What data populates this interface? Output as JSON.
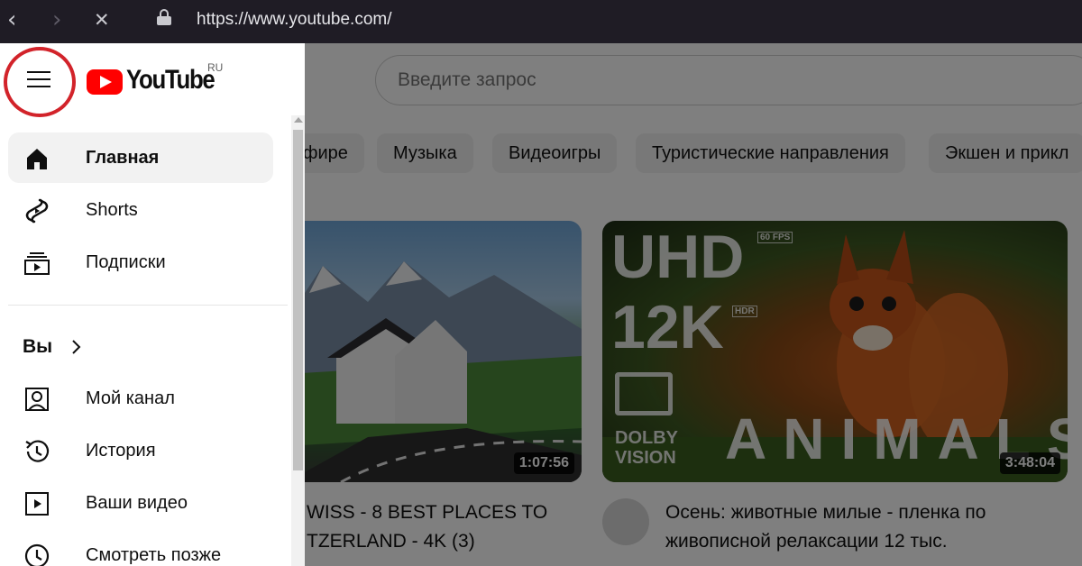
{
  "browser": {
    "back_glyph": "‹",
    "forward_glyph": "›",
    "stop_glyph": "✕",
    "url": "https://www.youtube.com/"
  },
  "header": {
    "logo_text": "YouTube",
    "logo_region": "RU",
    "search_placeholder": "Введите запрос",
    "accent_color": "#ff0000",
    "highlight_color": "#d2232a"
  },
  "chips": [
    "фире",
    "Музыка",
    "Видеоигры",
    "Туристические направления",
    "Экшен и прикл"
  ],
  "videos": [
    {
      "title_line1": "WISS - 8 BEST PLACES TO",
      "title_line2": "TZERLAND - 4K (3)",
      "duration": "1:07:56"
    },
    {
      "title_line1": "Осень: животные милые - пленка по",
      "title_line2": "живописной релаксации 12 тыс.",
      "duration": "3:48:04",
      "overlay_uhd": "UHD",
      "overlay_12k": "12K",
      "overlay_fps": "60 FPS",
      "overlay_hdr": "HDR",
      "overlay_dolby": "DOLBY",
      "overlay_vision": "VISION",
      "overlay_animals": "ANIMALS"
    }
  ],
  "sidebar": {
    "items": [
      {
        "label": "Главная",
        "icon": "home-icon",
        "active": true
      },
      {
        "label": "Shorts",
        "icon": "shorts-icon",
        "active": false
      },
      {
        "label": "Подписки",
        "icon": "subscriptions-icon",
        "active": false
      }
    ],
    "you_section": {
      "title": "Вы",
      "chevron": "chevron-right-icon",
      "items": [
        {
          "label": "Мой канал",
          "icon": "channel-icon"
        },
        {
          "label": "История",
          "icon": "history-icon"
        },
        {
          "label": "Ваши видео",
          "icon": "your-videos-icon"
        },
        {
          "label": "Смотреть позже",
          "icon": "watch-later-icon"
        }
      ]
    }
  }
}
